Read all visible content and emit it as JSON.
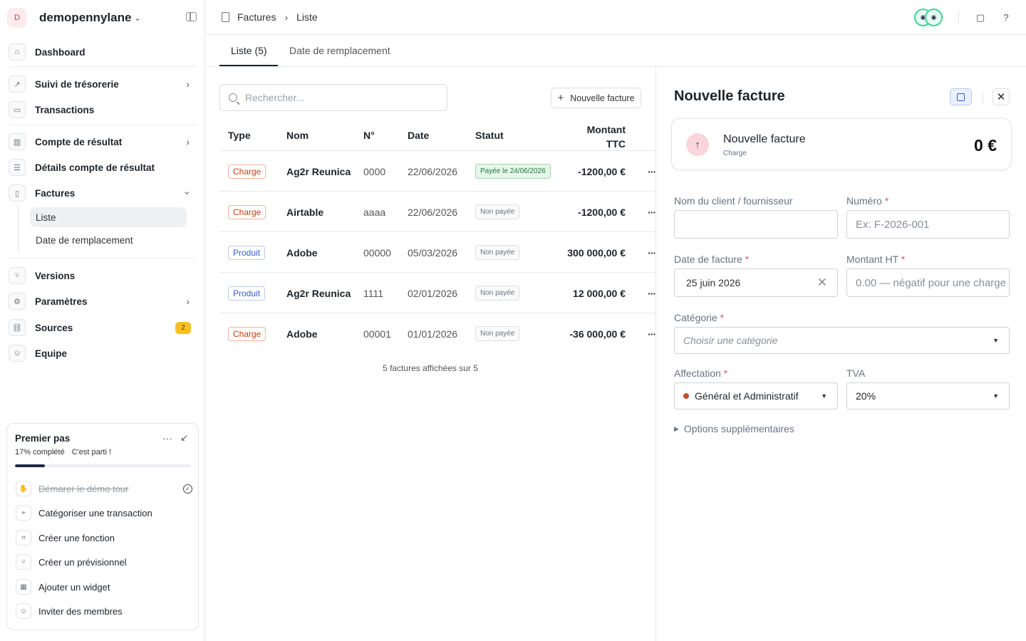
{
  "workspace": {
    "avatar": "D",
    "name": "demopennylane"
  },
  "sidebar": {
    "items": [
      {
        "label": "Dashboard",
        "icon": "home-icon"
      },
      {
        "label": "Suivi de trésorerie",
        "icon": "chart-icon"
      },
      {
        "label": "Transactions",
        "icon": "card-icon"
      },
      {
        "label": "Compte de résultat",
        "icon": "bar-chart-icon"
      },
      {
        "label": "Détails compte de résultat",
        "icon": "list-icon"
      },
      {
        "label": "Factures",
        "icon": "document-icon"
      },
      {
        "label": "Versions",
        "icon": "branch-icon"
      },
      {
        "label": "Paramètres",
        "icon": "gear-icon"
      },
      {
        "label": "Sources",
        "icon": "link-icon",
        "badge": "2"
      },
      {
        "label": "Equipe",
        "icon": "user-icon"
      }
    ],
    "factures_sub": [
      "Liste",
      "Date de remplacement"
    ]
  },
  "onboarding": {
    "title": "Premier pas",
    "progress_text": "17% complété",
    "encouragement": "C'est parti !",
    "progress": 0.17,
    "items": [
      {
        "label": "Démarer le démo tour",
        "done": true
      },
      {
        "label": "Catégoriser une transaction",
        "done": false
      },
      {
        "label": "Créer une fonction",
        "done": false
      },
      {
        "label": "Créer un prévisionnel",
        "done": false
      },
      {
        "label": "Ajouter un widget",
        "done": false
      },
      {
        "label": "Inviter des membres",
        "done": false
      }
    ]
  },
  "breadcrumb": {
    "root": "Factures",
    "current": "Liste"
  },
  "tabs": [
    "Liste (5)",
    "Date de remplacement"
  ],
  "search": {
    "placeholder": "Rechercher..."
  },
  "new_invoice_button": "Nouvelle facture",
  "table": {
    "headers": {
      "type": "Type",
      "nom": "Nom",
      "num": "N°",
      "date": "Date",
      "statut": "Statut",
      "montant_1": "Montant",
      "montant_2": "TTC"
    },
    "rows": [
      {
        "type": "Charge",
        "nom": "Ag2r Reunica",
        "num": "0000",
        "date": "22/06/2026",
        "statut": "Payée le 24/06/2026",
        "paid": true,
        "montant": "-1200,00 €"
      },
      {
        "type": "Charge",
        "nom": "Airtable",
        "num": "aaaa",
        "date": "22/06/2026",
        "statut": "Non payée",
        "paid": false,
        "montant": "-1200,00 €"
      },
      {
        "type": "Produit",
        "nom": "Adobe",
        "num": "00000",
        "date": "05/03/2026",
        "statut": "Non payée",
        "paid": false,
        "montant": "300 000,00 €"
      },
      {
        "type": "Produit",
        "nom": "Ag2r Reunica",
        "num": "1111",
        "date": "02/01/2026",
        "statut": "Non payée",
        "paid": false,
        "montant": "12 000,00 €"
      },
      {
        "type": "Charge",
        "nom": "Adobe",
        "num": "00001",
        "date": "01/01/2026",
        "statut": "Non payée",
        "paid": false,
        "montant": "-36 000,00 €"
      }
    ],
    "more": "···",
    "footer": "5 factures affichées sur 5"
  },
  "panel": {
    "title": "Nouvelle facture",
    "summary": {
      "title": "Nouvelle facture",
      "subtitle": "Charge",
      "amount": "0 €"
    },
    "fields": {
      "client_label": "Nom du client / fournisseur",
      "numero_label": "Numéro",
      "numero_placeholder": "Ex: F-2026-001",
      "date_label": "Date de facture",
      "date_value": "25 juin 2026",
      "montant_label": "Montant HT",
      "montant_placeholder": "0.00 — négatif pour une charge",
      "categorie_label": "Catégorie",
      "categorie_placeholder": "Choisir une catégorie",
      "affectation_label": "Affectation",
      "affectation_value": "Général et Administratif",
      "tva_label": "TVA",
      "tva_value": "20%",
      "required_mark": "*"
    },
    "options_label": "Options supplémentaires"
  },
  "colors": {
    "accent": "#2f5fd0",
    "charge": "#c2410c",
    "paid": "#1f7a3a",
    "badge": "#fbbf24"
  }
}
